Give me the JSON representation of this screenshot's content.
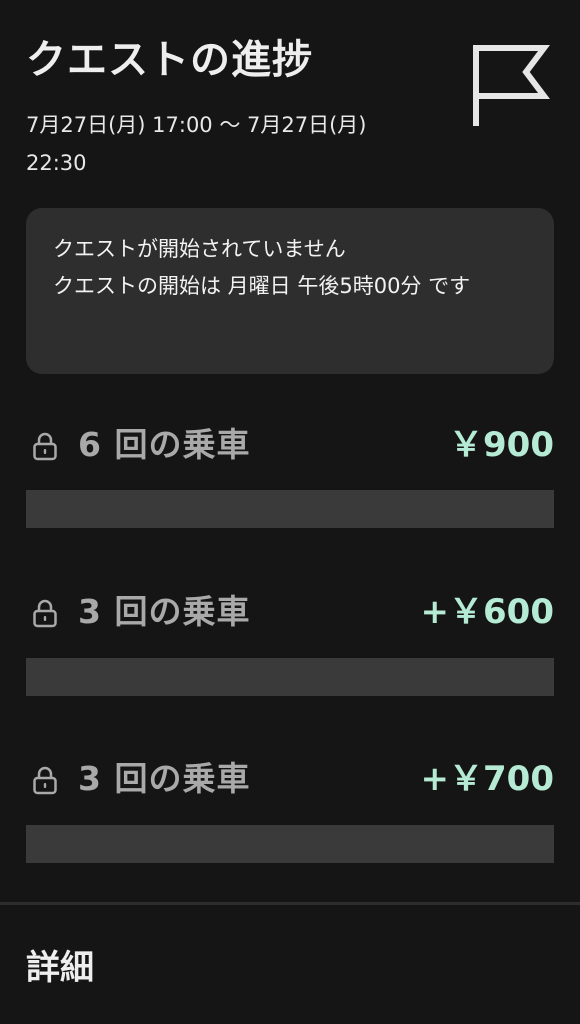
{
  "header": {
    "title": "クエストの進捗",
    "date_range": "7月27日(月) 17:00 〜 7月27日(月) 22:30",
    "flag_icon": "flag-icon"
  },
  "notice": {
    "title": "クエストが開始されていません",
    "body": "クエストの開始は 月曜日 午後5時00分 です"
  },
  "quests": [
    {
      "label": "6 回の乗車",
      "reward": "￥900",
      "locked": true,
      "progress": 0
    },
    {
      "label": "3 回の乗車",
      "reward": "+￥600",
      "locked": true,
      "progress": 0
    },
    {
      "label": "3 回の乗車",
      "reward": "+￥700",
      "locked": true,
      "progress": 0
    }
  ],
  "details": {
    "title": "詳細"
  },
  "colors": {
    "background": "#151515",
    "card": "#2e2e2e",
    "accent": "#b5ead4",
    "muted_text": "#a9a9a9",
    "track": "#3a3a3a"
  }
}
